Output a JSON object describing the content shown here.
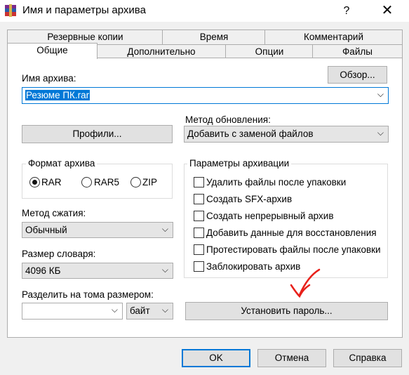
{
  "window": {
    "title": "Имя и параметры архива",
    "help_glyph": "?",
    "close_glyph": "✕"
  },
  "tabs_back": [
    "Резервные копии",
    "Время",
    "Комментарий"
  ],
  "tabs_front": [
    "Общие",
    "Дополнительно",
    "Опции",
    "Файлы"
  ],
  "archive_name": {
    "label": "Имя архива:",
    "value": "Резюме ПК.rar",
    "browse_label": "Обзор..."
  },
  "profiles_label": "Профили...",
  "update_method": {
    "label": "Метод обновления:",
    "value": "Добавить с заменой файлов"
  },
  "archive_format": {
    "title": "Формат архива",
    "options": [
      "RAR",
      "RAR5",
      "ZIP"
    ],
    "selected": "RAR"
  },
  "archive_options": {
    "title": "Параметры архивации",
    "items": [
      "Удалить файлы после упаковки",
      "Создать SFX-архив",
      "Создать непрерывный архив",
      "Добавить данные для восстановления",
      "Протестировать файлы после упаковки",
      "Заблокировать архив"
    ]
  },
  "compression": {
    "label": "Метод сжатия:",
    "value": "Обычный"
  },
  "dictionary": {
    "label": "Размер словаря:",
    "value": "4096 КБ"
  },
  "split": {
    "label": "Разделить на тома размером:",
    "value": "",
    "unit": "байт"
  },
  "set_password_label": "Установить пароль...",
  "dropdown_glyph": "⌵",
  "buttons": {
    "ok": "OK",
    "cancel": "Отмена",
    "help": "Справка"
  },
  "colors": {
    "accent": "#0078d7",
    "annotation_arrow": "#e8201a"
  }
}
